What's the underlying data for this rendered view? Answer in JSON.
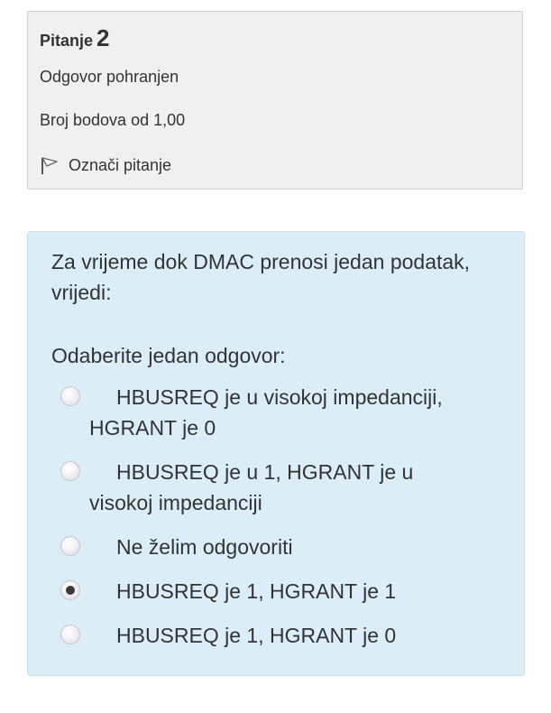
{
  "question_info": {
    "heading_label": "Pitanje",
    "number": "2",
    "state": "Odgovor pohranjen",
    "mark": "Broj bodova od 1,00",
    "flag_label": "Označi pitanje"
  },
  "question": {
    "text": "Za vrijeme dok DMAC prenosi jedan podatak, vrijedi:",
    "prompt": "Odaberite jedan odgovor:",
    "answers": [
      {
        "label": "HBUSREQ je u visokoj impedanciji, HGRANT je 0",
        "selected": false
      },
      {
        "label": "HBUSREQ je u 1, HGRANT je u visokoj impedanciji",
        "selected": false
      },
      {
        "label": "Ne želim odgovoriti",
        "selected": false
      },
      {
        "label": "HBUSREQ je 1, HGRANT je 1",
        "selected": true
      },
      {
        "label": "HBUSREQ je 1, HGRANT je 0",
        "selected": false
      }
    ]
  },
  "colors": {
    "info_background": "#f0f0f0",
    "question_background": "#dbeef7",
    "text": "#333333"
  },
  "icons": {
    "flag": "flag-icon",
    "radio": "radio-button"
  }
}
